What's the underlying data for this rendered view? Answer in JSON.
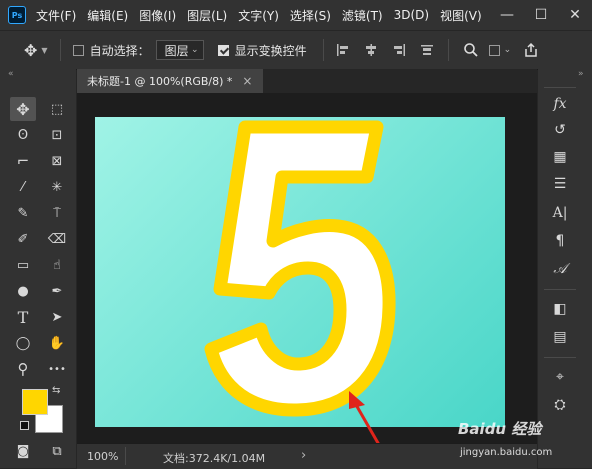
{
  "app": {
    "logo": "Ps"
  },
  "menubar": {
    "items": [
      "文件(F)",
      "编辑(E)",
      "图像(I)",
      "图层(L)",
      "文字(Y)",
      "选择(S)",
      "滤镜(T)",
      "3D(D)",
      "视图(V)"
    ]
  },
  "window_controls": {
    "minimize": "—",
    "maximize": "☐",
    "close": "✕"
  },
  "options_bar": {
    "auto_select_label": "自动选择：",
    "auto_select_checked": false,
    "layer_select_value": "图层",
    "show_transform_label": "显示变换控件",
    "show_transform_checked": true
  },
  "document": {
    "tab_title": "未标题-1 @ 100%(RGB/8) *",
    "tab_close": "×"
  },
  "canvas": {
    "digit": "5",
    "gradient_colors": [
      "#a0f3e6",
      "#49d6c8"
    ],
    "digit_fill": "#ffffff",
    "digit_stroke": "#ffd600",
    "arrow_color": "#e0241b"
  },
  "status": {
    "zoom": "100%",
    "doc_info": "文档:372.4K/1.04M",
    "next": "›"
  },
  "colors": {
    "foreground": "#ffd600",
    "background": "#ffffff",
    "accent": "#31a8ff"
  },
  "watermark": {
    "text": "Baidu 经验",
    "url": "jingyan.baidu.com"
  },
  "tools": {
    "move": "✥",
    "marquee": "⬚",
    "lasso": "ʘ",
    "quick_select": "⊡",
    "crop": "⌐",
    "frame": "⊠",
    "eyedropper": "⁄",
    "spot_heal": "✳",
    "brush": "✎",
    "stamp": "⍑",
    "history_brush": "✐",
    "eraser": "⌫",
    "gradient": "▭",
    "smudge": "☝",
    "dodge": "●",
    "pen": "✒",
    "type": "T",
    "path_select": "➤",
    "ellipse": "◯",
    "hand": "✋",
    "zoom": "⚲",
    "more": "•••",
    "swap": "⇆",
    "quickmask": "◙",
    "screen_mode": "⧉"
  },
  "right_panel": {
    "icons": [
      "fx",
      "↺",
      "▦",
      "☰",
      "A|",
      "¶",
      "𝒜",
      "◧",
      "▤",
      "⌖",
      "⛭"
    ]
  }
}
